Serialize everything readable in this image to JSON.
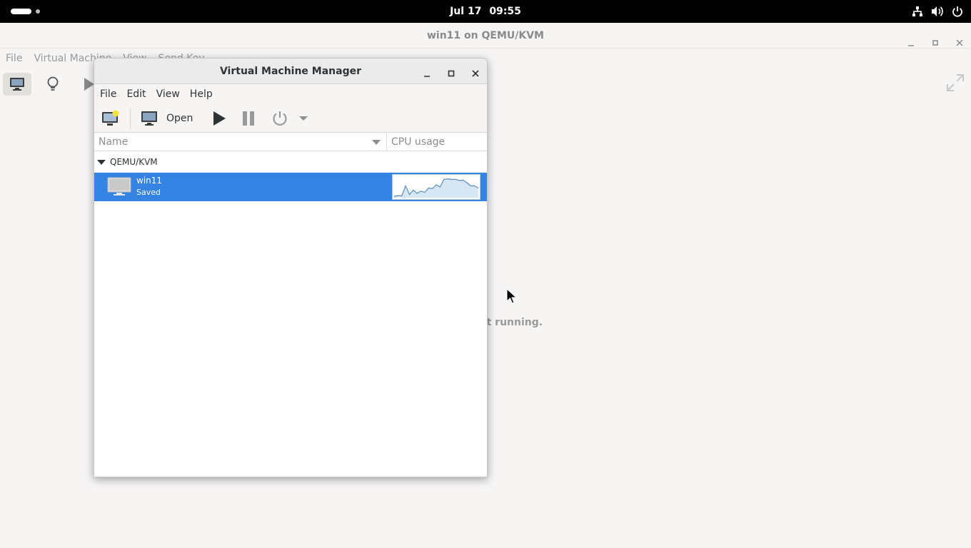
{
  "topbar": {
    "date": "Jul 17",
    "time": "09:55",
    "tray_icons": [
      "network-icon",
      "volume-icon",
      "power-icon"
    ]
  },
  "viewer": {
    "title": "win11 on QEMU/KVM",
    "menu": [
      "File",
      "Virtual Machine",
      "View",
      "Send Key"
    ],
    "status_text": "ot running."
  },
  "vmm": {
    "title": "Virtual Machine Manager",
    "menu": [
      "File",
      "Edit",
      "View",
      "Help"
    ],
    "toolbar": {
      "open_label": "Open"
    },
    "columns": {
      "name": "Name",
      "cpu": "CPU usage"
    },
    "groups": [
      {
        "label": "QEMU/KVM",
        "vms": [
          {
            "name": "win11",
            "state": "Saved"
          }
        ]
      }
    ],
    "cpu_samples": [
      0.05,
      0.1,
      0.08,
      0.55,
      0.15,
      0.35,
      0.2,
      0.3,
      0.25,
      0.45,
      0.42,
      0.6,
      0.5,
      0.85,
      0.88,
      0.85,
      0.86,
      0.8,
      0.82,
      0.7,
      0.55,
      0.55,
      0.45
    ],
    "accent_color": "#3584e4"
  }
}
